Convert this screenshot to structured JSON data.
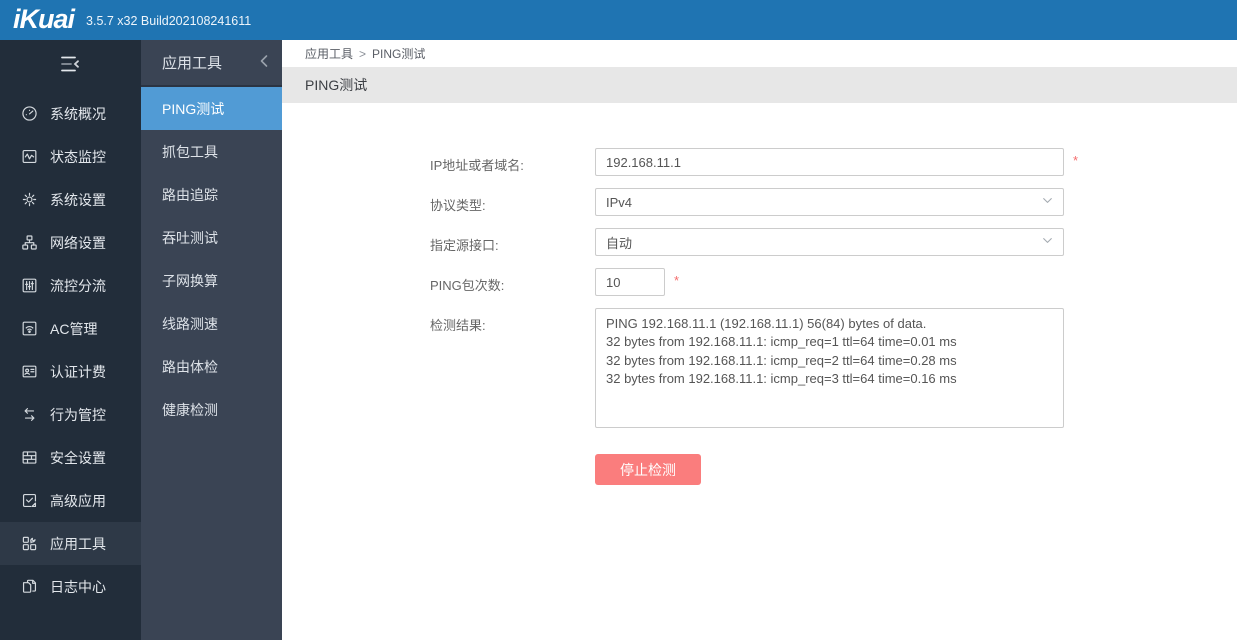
{
  "topbar": {
    "logo": "iKuai",
    "version": "3.5.7 x32 Build202108241611"
  },
  "colors": {
    "topbar_blue": "#1f74b2",
    "sidebar_dark": "#222d3a",
    "sidebar_secondary": "#3a4454",
    "active_blue": "#519bd5",
    "stop_button_red": "#fa7d7d",
    "required_red": "#f56c6c",
    "titlebar_gray": "#e7e7e7"
  },
  "sidebar": {
    "items": [
      {
        "label": "系统概况",
        "icon": "gauge-icon",
        "active": false
      },
      {
        "label": "状态监控",
        "icon": "monitor-wave-icon",
        "active": false
      },
      {
        "label": "系统设置",
        "icon": "gear-icon",
        "active": false
      },
      {
        "label": "网络设置",
        "icon": "network-icon",
        "active": false
      },
      {
        "label": "流控分流",
        "icon": "sliders-icon",
        "active": false
      },
      {
        "label": "AC管理",
        "icon": "wifi-icon",
        "active": false
      },
      {
        "label": "认证计费",
        "icon": "id-card-icon",
        "active": false
      },
      {
        "label": "行为管控",
        "icon": "swap-arrows-icon",
        "active": false
      },
      {
        "label": "安全设置",
        "icon": "firewall-icon",
        "active": false
      },
      {
        "label": "高级应用",
        "icon": "app-check-icon",
        "active": false
      },
      {
        "label": "应用工具",
        "icon": "tools-grid-icon",
        "active": true
      },
      {
        "label": "日志中心",
        "icon": "log-copy-icon",
        "active": false
      }
    ]
  },
  "submenu": {
    "title": "应用工具",
    "items": [
      {
        "label": "PING测试",
        "active": true
      },
      {
        "label": "抓包工具",
        "active": false
      },
      {
        "label": "路由追踪",
        "active": false
      },
      {
        "label": "吞吐测试",
        "active": false
      },
      {
        "label": "子网换算",
        "active": false
      },
      {
        "label": "线路测速",
        "active": false
      },
      {
        "label": "路由体检",
        "active": false
      },
      {
        "label": "健康检测",
        "active": false
      }
    ]
  },
  "breadcrumb": {
    "parent": "应用工具",
    "separator": ">",
    "current": "PING测试"
  },
  "page": {
    "title": "PING测试"
  },
  "form": {
    "ip_label": "IP地址或者域名:",
    "ip_value": "192.168.11.1",
    "protocol_label": "协议类型:",
    "protocol_value": "IPv4",
    "iface_label": "指定源接口:",
    "iface_value": "自动",
    "count_label": "PING包次数:",
    "count_value": "10",
    "result_label": "检测结果:",
    "result_text": "PING 192.168.11.1 (192.168.11.1) 56(84) bytes of data.\n32 bytes from 192.168.11.1: icmp_req=1 ttl=64 time=0.01 ms\n32 bytes from 192.168.11.1: icmp_req=2 ttl=64 time=0.28 ms\n32 bytes from 192.168.11.1: icmp_req=3 ttl=64 time=0.16 ms",
    "required_marker": "*",
    "stop_button": "停止检测"
  }
}
